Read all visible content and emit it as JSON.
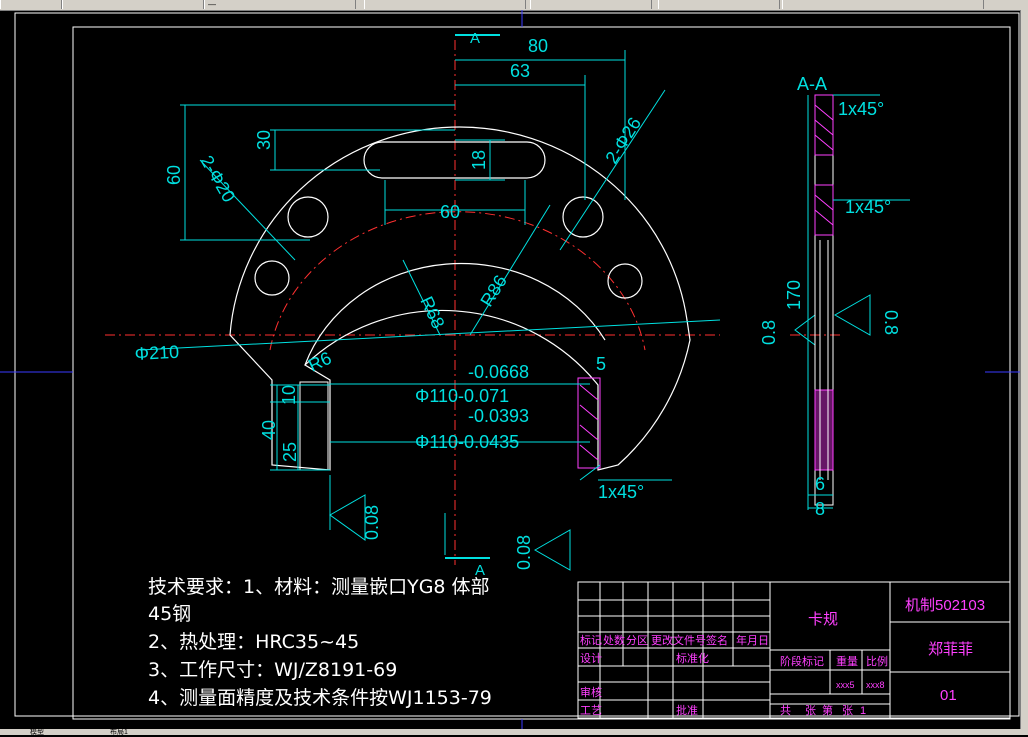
{
  "toolbar": {
    "segments": [
      "",
      "",
      "",
      "",
      "",
      "",
      ""
    ],
    "field_text": "—"
  },
  "drawing": {
    "dims": {
      "d80": "80",
      "d63": "63",
      "d30": "30",
      "d60v": "60",
      "d18": "18",
      "d60h": "60",
      "d2phi20": "2-Φ20",
      "d2phi26": "2-Φ26",
      "r86": "R86",
      "r68": "R68",
      "r6": "R6",
      "phi210": "Φ210",
      "tol1": "-0.0668",
      "tol1b": "Φ110-0.071",
      "tol2": "-0.0393",
      "tol2b": "Φ110-0.0435",
      "d10": "10",
      "d25": "25",
      "d40": "40",
      "d5": "5",
      "chamfer1": "1x45°",
      "chamfer2": "1x45°",
      "chamfer3": "1x45°",
      "d170": "170",
      "rough1": "0.8",
      "rough2": "0.8",
      "rough3": "0.08",
      "rough4": "0.8",
      "rough5": "0.08",
      "d6": "6",
      "d8": "8",
      "section": "A-A",
      "secA_top": "A",
      "secA_bot": "A"
    }
  },
  "tech": {
    "line1": "技术要求：1、材料：测量嵌口YG8  体部",
    "line1b": "45钢",
    "line2": "2、热处理：HRC35~45",
    "line3": "3、工作尺寸：WJ/Z8191-69",
    "line4": "4、测量面精度及技术条件按WJ1153-79"
  },
  "titleblock": {
    "name": "卡规",
    "code": "机制502103",
    "author": "郑菲菲",
    "sheet": "01",
    "h1": "标记",
    "h2": "处数",
    "h3": "分区",
    "h4": "更改文件号",
    "h5": "签名",
    "h6": "年月日",
    "r1": "设计",
    "r1b": "标准化",
    "r2": "审核",
    "r3": "工艺",
    "r3b": "批准",
    "stage": "阶段标记",
    "weight": "重量",
    "scale": "比例",
    "w_val": "xxx5",
    "s_val": "xxx8",
    "total": "共",
    "sheets": "张",
    "page": "第",
    "page2": "张",
    "page_num": "1"
  },
  "statusbar": {
    "left": "模型",
    "right": "布局1"
  }
}
